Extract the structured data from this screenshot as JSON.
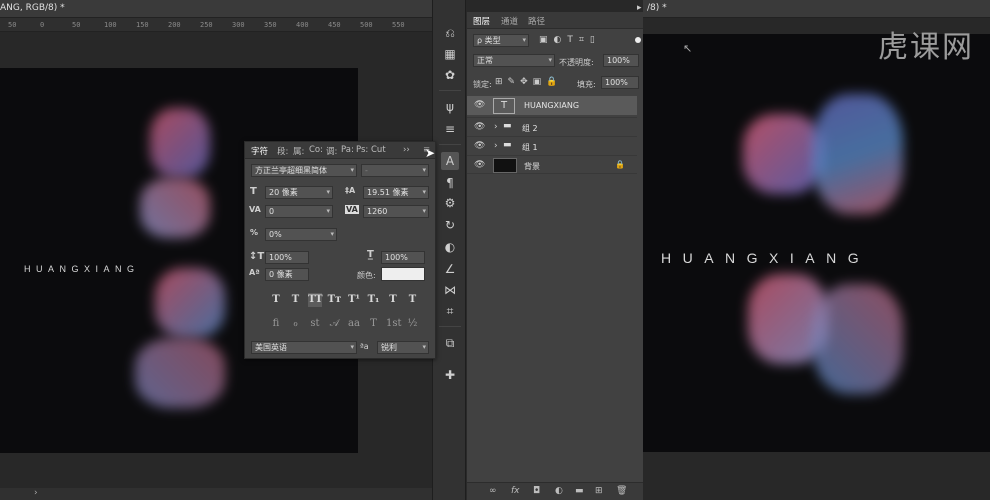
{
  "left_document": {
    "tab_title": "ANG, RGB/8) *",
    "ruler_ticks": [
      "50",
      "0",
      "50",
      "100",
      "150",
      "200",
      "250",
      "300",
      "350",
      "400",
      "450",
      "500",
      "550"
    ],
    "canvas_text": "HUANGXIANG",
    "status_text": "›"
  },
  "right_document": {
    "tab_title": "/8) *",
    "canvas_text": "HUANGXIANG",
    "watermark": "虎课网"
  },
  "character_panel": {
    "tabs": [
      "字符",
      "段:",
      "属:",
      "Co:",
      "调:",
      "Pa:",
      "Ps:",
      "Cut"
    ],
    "font_family": "方正兰亭超细黑简体",
    "font_style": "-",
    "font_size": "20 像素",
    "leading": "19.51 像素",
    "kerning": "0",
    "tracking": "1260",
    "tsume": "0%",
    "vertical_scale": "100%",
    "horizontal_scale": "100%",
    "baseline_shift": "0 像素",
    "color_label": "颜色:",
    "color_value": "#eeeeee",
    "language": "美国英语",
    "aa_label": "ªa",
    "antialias": "锐利",
    "format_buttons": [
      "T",
      "T",
      "TT",
      "Tт",
      "T¹",
      "T₁",
      "T",
      "T"
    ],
    "opentype_buttons": [
      "fi",
      "ℴ",
      "st",
      "𝒜",
      "aa",
      "T",
      "1st",
      "½"
    ]
  },
  "layers_panel": {
    "tabs": [
      "图层",
      "通道",
      "路径"
    ],
    "filter_kind": "ρ 类型",
    "blend_mode": "正常",
    "opacity_label": "不透明度:",
    "opacity_value": "100%",
    "lock_label": "锁定:",
    "fill_label": "填充:",
    "fill_value": "100%",
    "layers": [
      {
        "name": "HUANGXIANG",
        "type": "text",
        "selected": true
      },
      {
        "name": "组 2",
        "type": "group"
      },
      {
        "name": "组 1",
        "type": "group"
      },
      {
        "name": "背景",
        "type": "background",
        "locked": true
      }
    ],
    "footer_icons": [
      "link-icon",
      "fx-icon",
      "mask-icon",
      "adjustment-icon",
      "folder-icon",
      "new-layer-icon",
      "trash-icon"
    ]
  },
  "colors": {
    "canvas": "#0b0b0d",
    "pink": "#e0607a",
    "blue": "#5b8fd0",
    "panel": "#434343"
  }
}
